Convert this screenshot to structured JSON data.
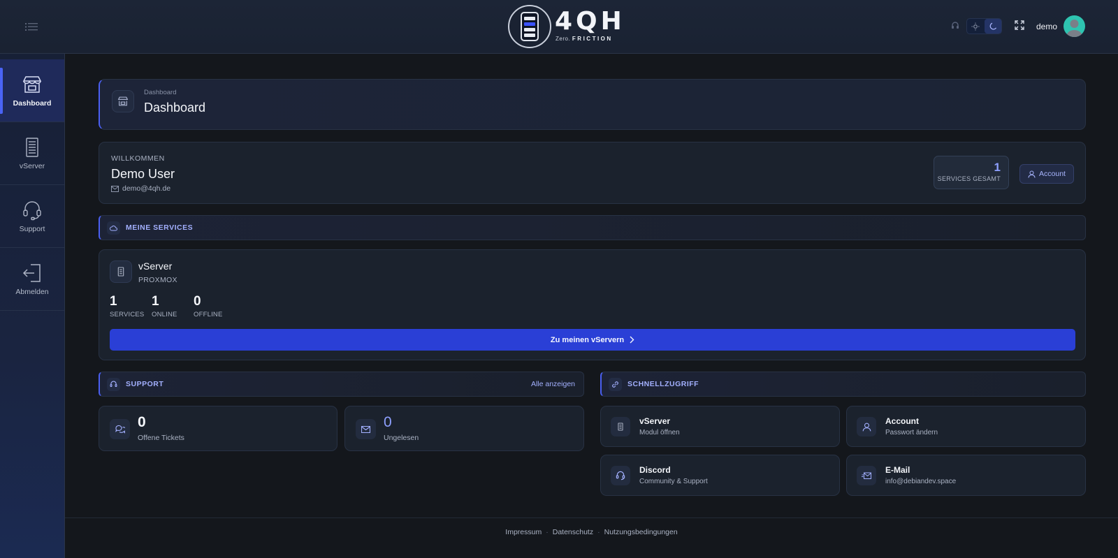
{
  "header": {
    "logo_word": "4QH",
    "logo_tag_prefix": "Zero.",
    "logo_tag_word": "FRICTION",
    "user_name": "demo"
  },
  "sidebar": {
    "items": [
      {
        "label": "Dashboard",
        "icon": "storefront-icon",
        "active": true
      },
      {
        "label": "vServer",
        "icon": "server-icon"
      },
      {
        "label": "Support",
        "icon": "headset-icon"
      },
      {
        "label": "Abmelden",
        "icon": "logout-icon"
      }
    ]
  },
  "page_head": {
    "breadcrumb": "Dashboard",
    "title": "Dashboard"
  },
  "welcome": {
    "kicker": "WILLKOMMEN",
    "name": "Demo User",
    "email": "demo@4qh.de",
    "services_total": "1",
    "services_total_label": "SERVICES GESAMT",
    "account_button": "Account"
  },
  "services_section": {
    "title": "MEINE SERVICES"
  },
  "vserver": {
    "title": "vServer",
    "subtitle": "PROXMOX",
    "stats": [
      {
        "value": "1",
        "label": "SERVICES"
      },
      {
        "value": "1",
        "label": "ONLINE"
      },
      {
        "value": "0",
        "label": "OFFLINE"
      }
    ],
    "button": "Zu meinen vServern"
  },
  "support_section": {
    "title": "SUPPORT",
    "link": "Alle anzeigen",
    "cards": [
      {
        "value": "0",
        "label": "Offene Tickets"
      },
      {
        "value": "0",
        "label": "Ungelesen"
      }
    ]
  },
  "quick_section": {
    "title": "SCHNELLZUGRIFF",
    "items": [
      {
        "title": "vServer",
        "subtitle": "Modul öffnen"
      },
      {
        "title": "Account",
        "subtitle": "Passwort ändern"
      },
      {
        "title": "Discord",
        "subtitle": "Community & Support"
      },
      {
        "title": "E-Mail",
        "subtitle": "info@debiandev.space"
      }
    ]
  },
  "footer": {
    "links": [
      "Impressum",
      "Datenschutz",
      "Nutzungsbedingungen"
    ],
    "separator": "·"
  },
  "colors": {
    "accent": "#4a5ff0",
    "button": "#2a3fd6",
    "accent_text": "#a3b0ff",
    "background": "#14171c"
  }
}
